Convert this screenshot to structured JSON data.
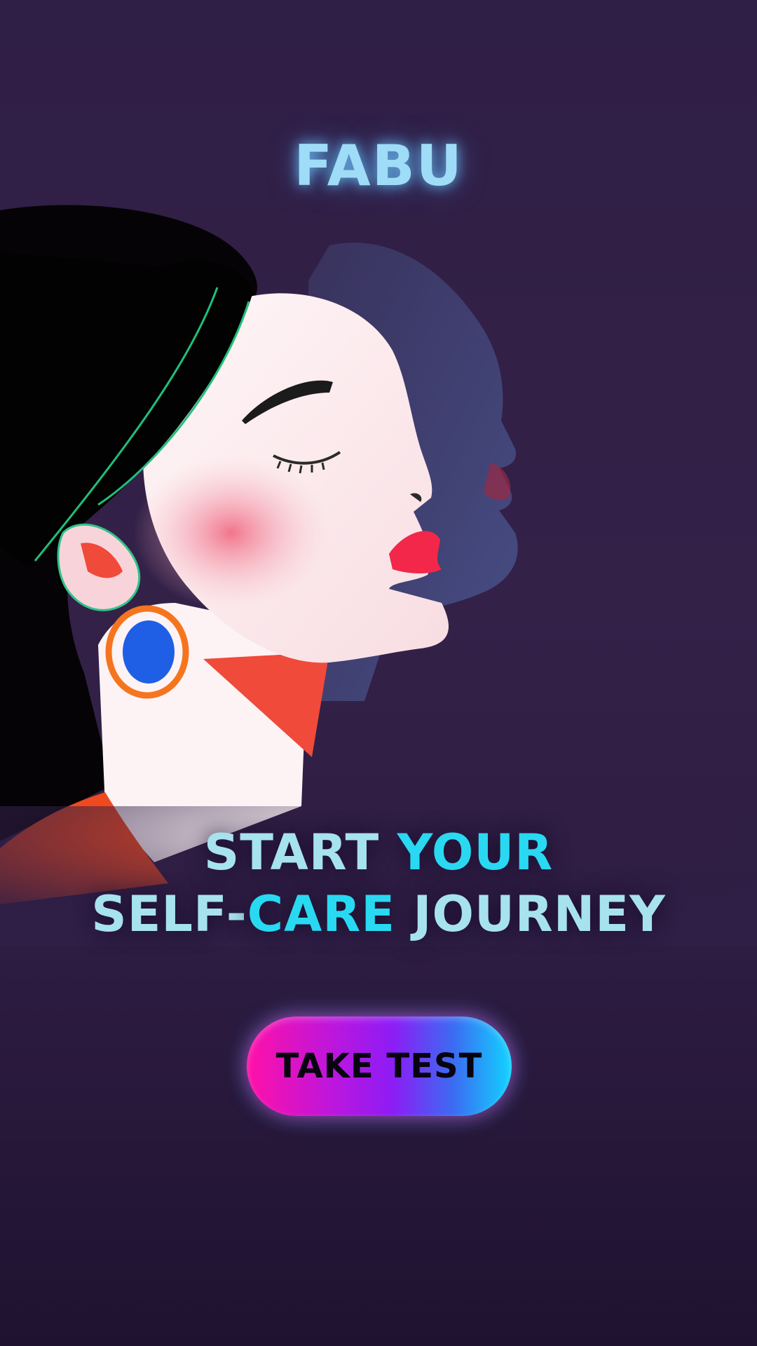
{
  "app": {
    "logo": "FABU"
  },
  "hero": {
    "headline_line1_part1": "START ",
    "headline_line1_part2": "YOUR",
    "headline_line2_part1": "SELF-",
    "headline_line2_part2": "CARE",
    "headline_line2_part3": " JOURNEY"
  },
  "cta": {
    "label": "TAKE TEST"
  },
  "colors": {
    "background": "#2f1e45",
    "logo": "#9fdcf7",
    "headline": "#a7e2ef",
    "headline_accent": "#29d9f2",
    "button_gradient_start": "#ff10a8",
    "button_gradient_end": "#12d3ff"
  },
  "icons": {
    "illustration": "woman-profile-illustration"
  }
}
